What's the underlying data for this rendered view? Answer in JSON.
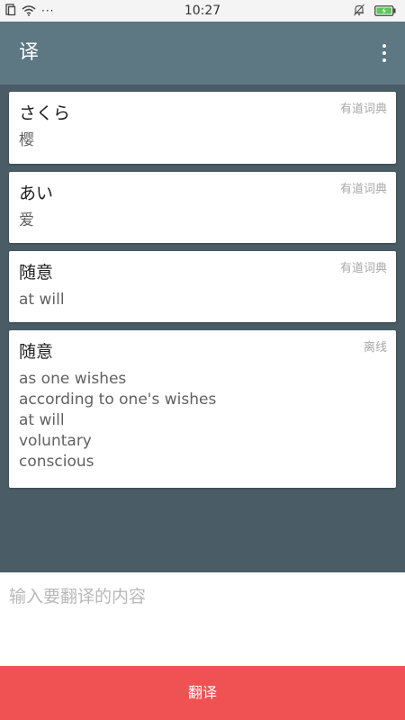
{
  "status_bar": {
    "time": "10:27",
    "dots": "···",
    "icons": [
      "sim-icon",
      "wifi-icon",
      "mute-icon",
      "battery-charging-icon"
    ]
  },
  "app_bar": {
    "title": "译",
    "menu_icon": "more-vert-icon"
  },
  "results": [
    {
      "word": "さくら",
      "source": "有道词典",
      "meanings": [
        "樱"
      ]
    },
    {
      "word": "あい",
      "source": "有道词典",
      "meanings": [
        "爱"
      ]
    },
    {
      "word": "随意",
      "source": "有道词典",
      "meanings": [
        "at will"
      ]
    },
    {
      "word": "随意",
      "source": "离线",
      "meanings": [
        "as one wishes",
        "according to one's wishes",
        "at will",
        "voluntary",
        "conscious"
      ]
    }
  ],
  "input": {
    "placeholder": "输入要翻译的内容",
    "value": ""
  },
  "translate_button": {
    "label": "翻译"
  },
  "colors": {
    "app_bar": "#5d7783",
    "background": "#4a5c66",
    "accent_button": "#f05253",
    "source_text": "#a8a8a8"
  }
}
